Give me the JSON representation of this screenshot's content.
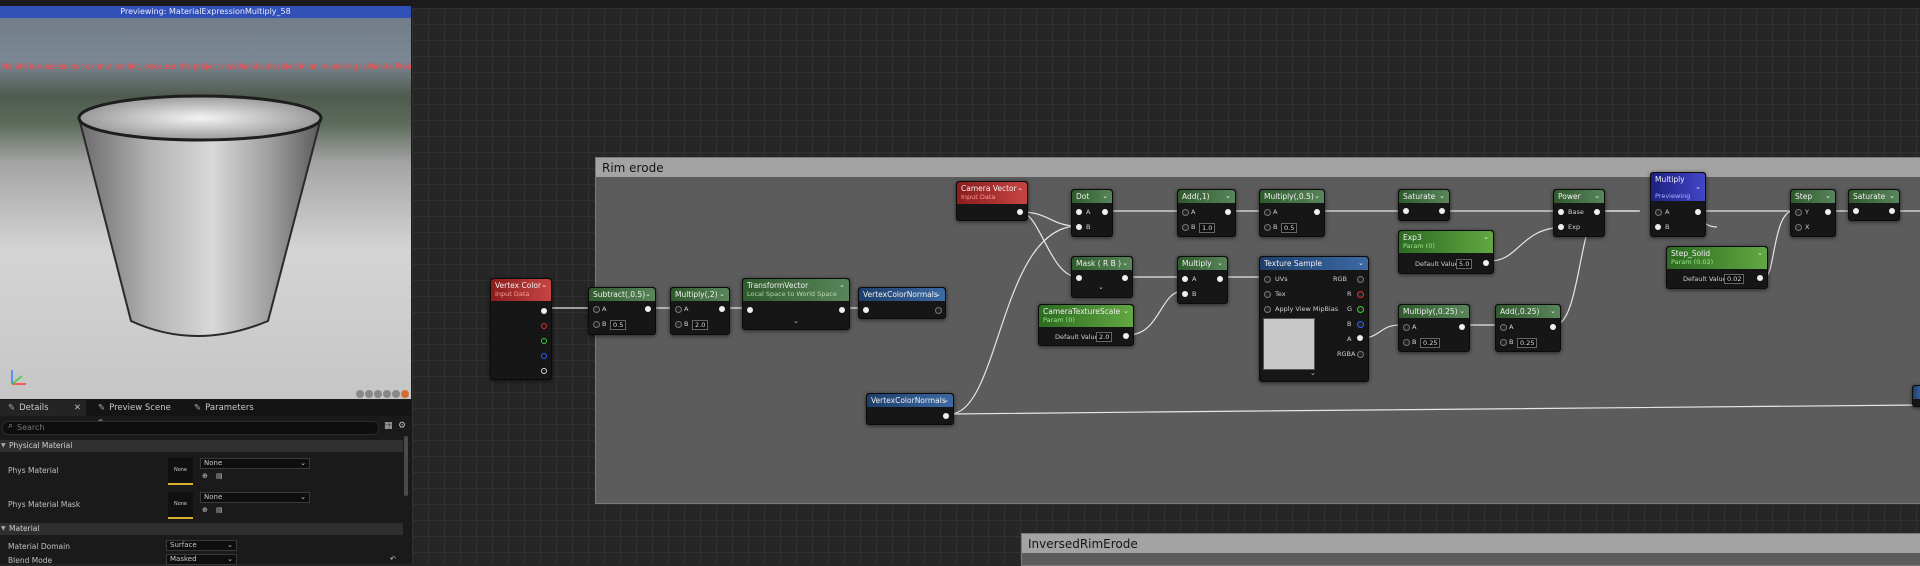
{
  "viewport": {
    "title": "Previewing: MaterialExpressionMultiply_58",
    "warning": "Nanite is enabled but cannot render, because the project has Nanite disabled in an rendering (r.Nanite.ProjectEnabled = 0)"
  },
  "details": {
    "tabs": [
      {
        "label": "Details",
        "icon": "pencil-icon"
      },
      {
        "label": "Preview Scene S...",
        "icon": "pencil-icon"
      },
      {
        "label": "Parameters",
        "icon": "pencil-icon"
      }
    ],
    "search_placeholder": "Search",
    "sections": [
      {
        "title": "Physical Material"
      },
      {
        "title": "Material"
      }
    ],
    "phys_material_label": "Phys Material",
    "phys_material_mask_label": "Phys Material Mask",
    "none_thumb": "None",
    "none_value": "None",
    "material_domain_label": "Material Domain",
    "material_domain_value": "Surface",
    "blend_mode_label": "Blend Mode",
    "blend_mode_value": "Masked"
  },
  "graph": {
    "comment_rim": "Rim erode",
    "comment_inversed": "InversedRimErode",
    "nodes": {
      "vertex_color": {
        "title": "Vertex Color",
        "subtitle": "Input Data"
      },
      "subtract": {
        "title": "Subtract(,0.5)",
        "pin_a": "A",
        "pin_b": "B",
        "b_value": "0.5"
      },
      "multiply2": {
        "title": "Multiply(,2)",
        "pin_a": "A",
        "pin_b": "B",
        "b_value": "2.0"
      },
      "transform": {
        "title": "TransformVector",
        "subtitle": "Local Space to World Space"
      },
      "vcn1": {
        "title": "VertexColorNormals"
      },
      "vcn2": {
        "title": "VertexColorNormals"
      },
      "camera_vector": {
        "title": "Camera Vector",
        "subtitle": "Input Data"
      },
      "dot": {
        "title": "Dot",
        "pin_a": "A",
        "pin_b": "B"
      },
      "mask": {
        "title": "Mask ( R B )"
      },
      "cam_tex_scale": {
        "title": "CameraTextureScale",
        "subtitle": "Param (0)",
        "default_label": "Default Value",
        "default_value": "2.0"
      },
      "add1": {
        "title": "Add(,1)",
        "pin_a": "A",
        "pin_b": "B",
        "b_value": "1.0"
      },
      "multiply_mid": {
        "title": "Multiply",
        "pin_a": "A",
        "pin_b": "B"
      },
      "multiply05": {
        "title": "Multiply(,0.5)",
        "pin_a": "A",
        "pin_b": "B",
        "b_value": "0.5"
      },
      "texture_sample": {
        "title": "Texture Sample",
        "pins_left": [
          "UVs",
          "Tex",
          "Apply View MipBias"
        ],
        "pins_right": [
          "RGB",
          "R",
          "G",
          "B",
          "A",
          "RGBA"
        ]
      },
      "saturate1": {
        "title": "Saturate"
      },
      "exp3": {
        "title": "Exp3",
        "subtitle": "Param (0)",
        "default_label": "Default Value",
        "default_value": "5.0"
      },
      "multiply025": {
        "title": "Multiply(,0.25)",
        "pin_a": "A",
        "pin_b": "B",
        "b_value": "0.25"
      },
      "add025": {
        "title": "Add(,0.25)",
        "pin_a": "A",
        "pin_b": "B",
        "b_value": "0.25"
      },
      "power": {
        "title": "Power",
        "pin_a": "Base",
        "pin_b": "Exp"
      },
      "multiply_preview": {
        "title": "Multiply",
        "subtitle": "Previewing",
        "pin_a": "A",
        "pin_b": "B"
      },
      "step_solid": {
        "title": "Step_Solid",
        "subtitle": "Param (0.02)",
        "default_label": "Default Value",
        "default_value": "0.02"
      },
      "step": {
        "title": "Step",
        "pin_a": "Y",
        "pin_b": "X"
      },
      "saturate2": {
        "title": "Saturate"
      }
    }
  },
  "colors": {
    "function_header": "#3a6a38",
    "input_data_header": "#a82c2c",
    "reroute_header": "#2e5a90",
    "previewing_header": "#3034a8",
    "param_header": "#4e9432",
    "red_pin": "#e03030",
    "green_pin": "#30d030",
    "blue_pin": "#3060ff"
  }
}
